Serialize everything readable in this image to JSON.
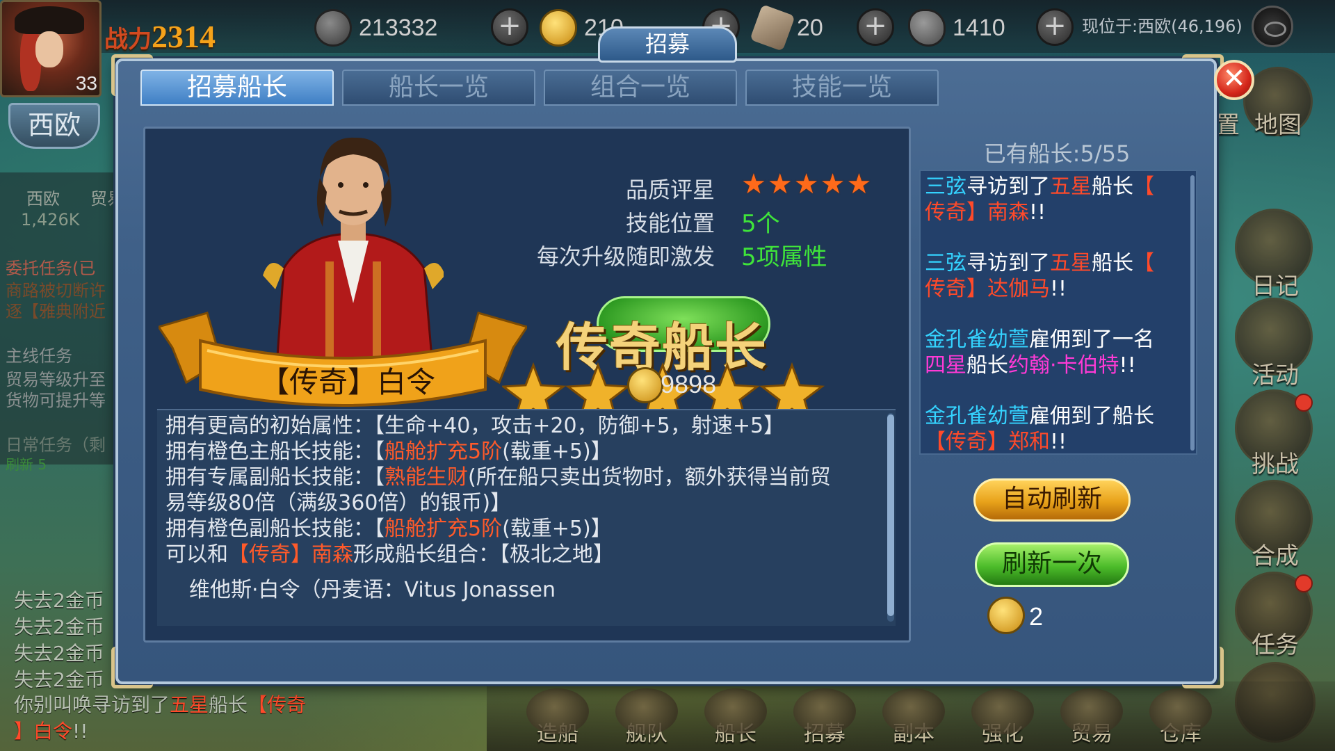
{
  "hud": {
    "player_level": "33",
    "power_label": "战力",
    "power_value": "2314",
    "region": "西欧",
    "silver": "213332",
    "gold_partial": "210",
    "scrolls": "20",
    "stone": "1410",
    "location": "现位于:西欧(46,196)"
  },
  "left_panels": {
    "trade_region": "西欧",
    "trade_label": "贸易",
    "trade_value": "1,426K",
    "delegate_title": "委托任务(已",
    "delegate_line1": "商路被切断许",
    "delegate_line2": "逐【雅典附近",
    "main_title": "主线任务",
    "main_line1": "贸易等级升至",
    "main_line2": "货物可提升等",
    "daily_title": "日常任务（剩",
    "daily_line1": "刷新 5"
  },
  "right_icons": {
    "settings_label": "置",
    "map_label": "地图",
    "diary_label": "日记",
    "activity_label": "活动",
    "challenge_label": "挑战",
    "compose_label": "合成",
    "task_label": "任务"
  },
  "bottom_nav": [
    {
      "label": "造船"
    },
    {
      "label": "舰队"
    },
    {
      "label": "船长"
    },
    {
      "label": "招募"
    },
    {
      "label": "副本"
    },
    {
      "label": "强化"
    },
    {
      "label": "贸易"
    },
    {
      "label": "仓库"
    }
  ],
  "dialog": {
    "title": "招募",
    "close_label": "✕",
    "tabs": [
      {
        "label": "招募船长",
        "active": true
      },
      {
        "label": "船长一览",
        "active": false
      },
      {
        "label": "组合一览",
        "active": false
      },
      {
        "label": "技能一览",
        "active": false
      }
    ],
    "captain": {
      "name": "【传奇】白令",
      "quality_label": "品质评星",
      "quality_stars": "★★★★★",
      "skill_slot_label": "技能位置",
      "skill_slot_value": "5个",
      "upgrade_label": "每次升级随即激发",
      "upgrade_value": "5项属性",
      "rank_title": "传奇船长",
      "recruit_cost": "9898"
    },
    "description": {
      "l1_a": "拥有更高的初始属性：",
      "l1_b": "【生命+40，攻击+20，防御+5，射速+5】",
      "l2_a": "拥有橙色主船长技能：",
      "l2_b": "【",
      "l2_c": "船舱扩充5阶",
      "l2_d": "(载重+5)】",
      "l3_a": "拥有专属副船长技能：",
      "l3_b": "【",
      "l3_c": "熟能生财",
      "l3_d": "(所在船只卖出货物时，额外获得当前贸",
      "l4": "易等级80倍（满级360倍）的银币)】",
      "l5_a": "拥有橙色副船长技能：",
      "l5_b": "【",
      "l5_c": "船舱扩充5阶",
      "l5_d": "(载重+5)】",
      "l6_a": "可以和",
      "l6_b": "【传奇】南森",
      "l6_c": "形成船长组合：",
      "l6_d": "【极北之地】",
      "l7": "维他斯·白令（丹麦语：Vitus Jonassen"
    },
    "owned_count": "已有船长:5/55",
    "news": [
      {
        "who": "三弦",
        "verb": "寻访到了",
        "rank": "五星",
        "mid": "船长",
        "open": "【",
        "name": "传奇】南森",
        "end": "!!"
      },
      {
        "who": "三弦",
        "verb": "寻访到了",
        "rank": "五星",
        "mid": "船长",
        "open": "【",
        "name": "传奇】达伽马",
        "end": "!!"
      },
      {
        "who": "金孔雀幼萱",
        "verb": "雇佣到了一名",
        "rank": "四星",
        "mid": "船长",
        "name": "约翰·卡伯特",
        "end": "!!"
      },
      {
        "who": "金孔雀幼萱",
        "verb": "雇佣到了船长",
        "name": "【传奇】郑和",
        "end": "!!"
      }
    ],
    "auto_refresh_label": "自动刷新",
    "refresh_once_label": "刷新一次",
    "refresh_cost": "2"
  },
  "chat": {
    "lines": [
      "失去2金币",
      "失去2金币",
      "失去2金币",
      "失去2金币"
    ],
    "last_a": "你别叫唤",
    "last_b": "寻访到了",
    "last_c": "五星",
    "last_d": "船长",
    "last_e": "【传奇",
    "last_f": "】白令",
    "last_g": "!!"
  }
}
